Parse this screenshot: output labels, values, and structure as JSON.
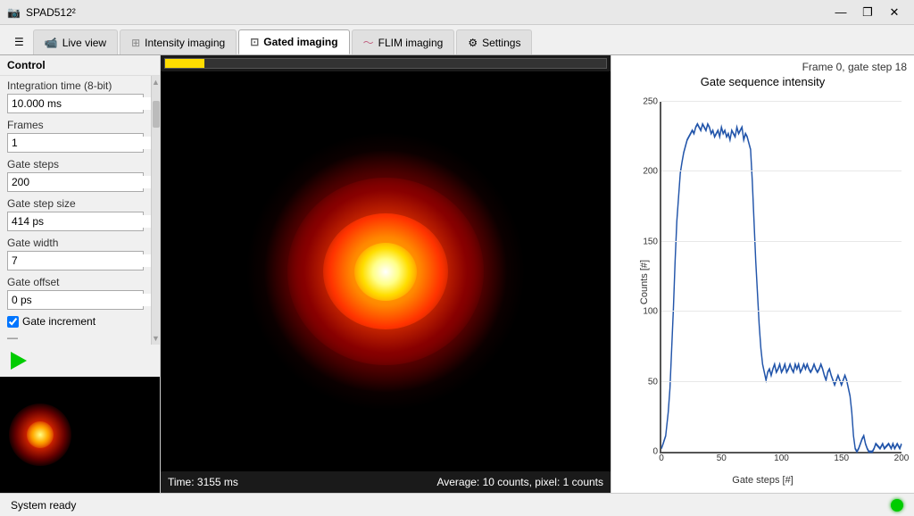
{
  "titleBar": {
    "title": "SPAD512²",
    "icon": "📷",
    "minBtn": "—",
    "maxBtn": "❐",
    "closeBtn": "✕"
  },
  "tabs": [
    {
      "id": "hamburger",
      "label": "☰",
      "icon": "",
      "active": false
    },
    {
      "id": "liveview",
      "label": "Live view",
      "icon": "📹",
      "active": false
    },
    {
      "id": "intensity",
      "label": "Intensity imaging",
      "icon": "⊞",
      "active": false
    },
    {
      "id": "gated",
      "label": "Gated imaging",
      "icon": "⊡",
      "active": true
    },
    {
      "id": "flim",
      "label": "FLIM imaging",
      "icon": "~",
      "active": false
    },
    {
      "id": "settings",
      "label": "Settings",
      "icon": "⚙",
      "active": false
    }
  ],
  "controlPanel": {
    "header": "Control",
    "fields": [
      {
        "id": "integration-time",
        "label": "Integration time (8-bit)",
        "value": "10.000 ms"
      },
      {
        "id": "frames",
        "label": "Frames",
        "value": "1"
      },
      {
        "id": "gate-steps",
        "label": "Gate steps",
        "value": "200"
      },
      {
        "id": "gate-step-size",
        "label": "Gate step size",
        "value": "414 ps"
      },
      {
        "id": "gate-width",
        "label": "Gate width",
        "value": "7"
      },
      {
        "id": "gate-offset",
        "label": "Gate offset",
        "value": "0 ps"
      }
    ],
    "checkbox": {
      "label": "Gate increment",
      "checked": true
    }
  },
  "imageArea": {
    "progressPercent": 9,
    "timeLabel": "Time: 3155 ms",
    "statsLabel": "Average: 10 counts, pixel: 1 counts"
  },
  "chartPanel": {
    "frameInfo": "Frame 0, gate step 18",
    "title": "Gate sequence intensity",
    "yAxisLabel": "Counts [#]",
    "xAxisLabel": "Gate steps [#]",
    "yTicks": [
      "0",
      "50",
      "100",
      "150",
      "200",
      "250"
    ],
    "xTicks": [
      "0",
      "50",
      "100",
      "150",
      "200"
    ]
  },
  "statusBar": {
    "text": "System ready",
    "ledColor": "#00cc00"
  }
}
